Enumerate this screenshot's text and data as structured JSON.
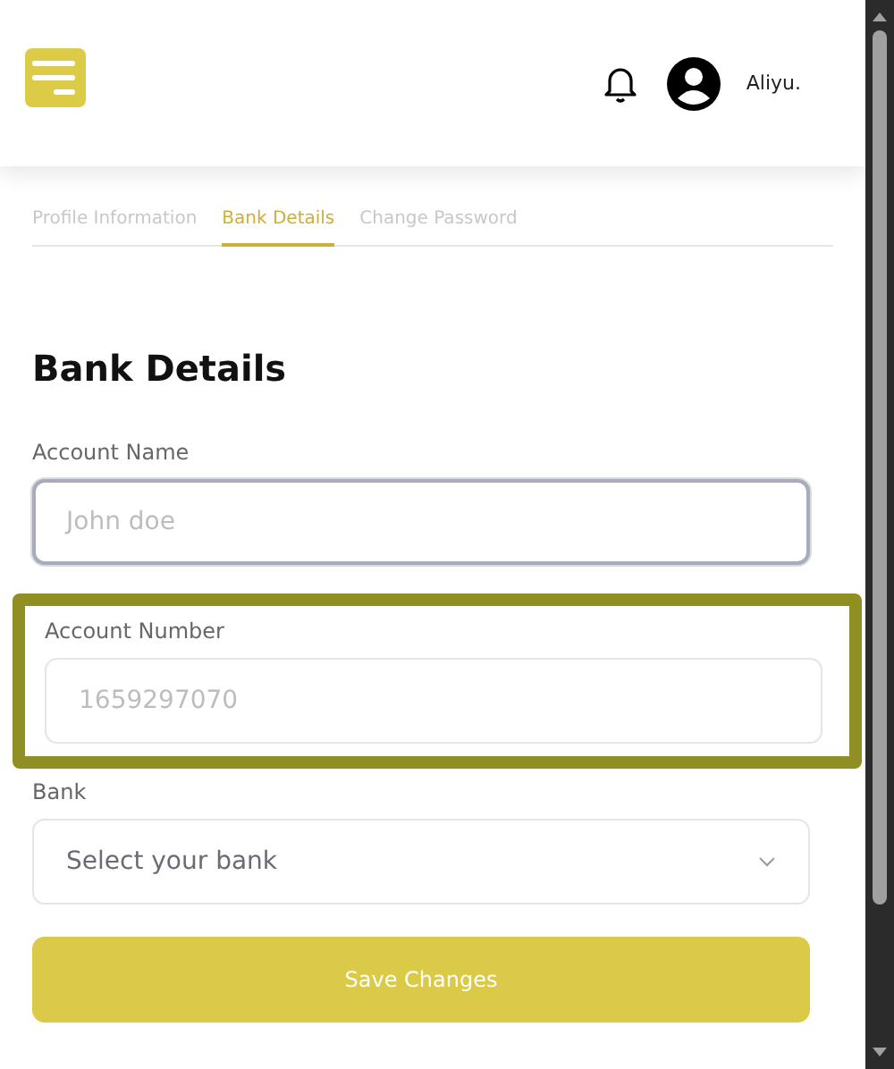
{
  "header": {
    "user_name": "Aliyu."
  },
  "tabs": [
    {
      "label": "Profile Information",
      "selected": false
    },
    {
      "label": "Bank Details",
      "selected": true
    },
    {
      "label": "Change Password",
      "selected": false
    }
  ],
  "section_title": "Bank Details",
  "fields": [
    {
      "kind": "text",
      "label": "Account Name",
      "placeholder": "John doe",
      "focused": true,
      "highlighted": false
    },
    {
      "kind": "text",
      "label": "Account Number",
      "placeholder": "1659297070",
      "focused": false,
      "highlighted": true
    },
    {
      "kind": "select",
      "label": "Bank",
      "placeholder": "Select your bank",
      "focused": false,
      "highlighted": false
    }
  ],
  "save_button": "Save Changes"
}
